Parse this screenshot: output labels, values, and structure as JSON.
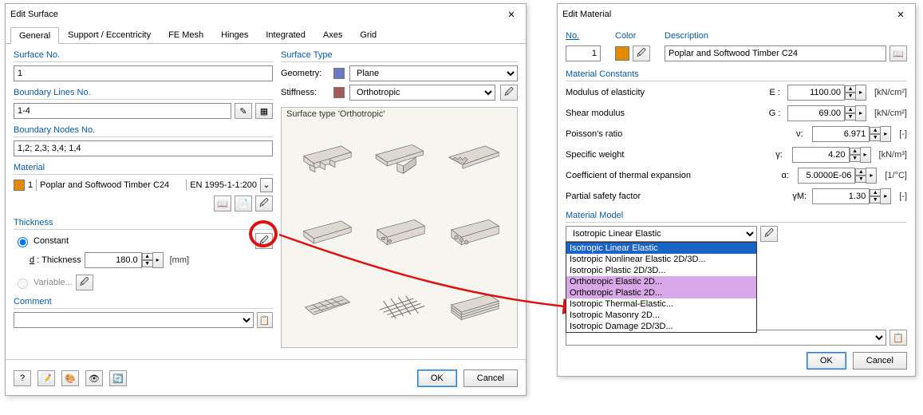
{
  "dlg1": {
    "title": "Edit Surface",
    "tabs": [
      "General",
      "Support / Eccentricity",
      "FE Mesh",
      "Hinges",
      "Integrated",
      "Axes",
      "Grid"
    ],
    "g_surface_no": "Surface No.",
    "surface_no": "1",
    "g_boundary_lines": "Boundary Lines No.",
    "boundary_lines": "1-4",
    "g_boundary_nodes": "Boundary Nodes No.",
    "boundary_nodes": "1,2; 2,3; 3,4; 1,4",
    "g_material": "Material",
    "material_index": "1",
    "material_name": "Poplar and Softwood Timber C24",
    "material_std": "EN 1995-1-1:200",
    "g_thickness": "Thickness",
    "thk_constant": "Constant",
    "thk_label": "Thickness d:",
    "thk_value": "180.0",
    "thk_unit": "[mm]",
    "thk_variable": "Variable...",
    "g_comment": "Comment",
    "g_surface_type": "Surface Type",
    "lbl_geometry": "Geometry:",
    "geometry": "Plane",
    "lbl_stiffness": "Stiffness:",
    "stiffness": "Orthotropic",
    "preview_caption": "Surface type 'Orthotropic'",
    "ok": "OK",
    "cancel": "Cancel"
  },
  "dlg2": {
    "title": "Edit Material",
    "lbl_no": "No.",
    "no": "1",
    "lbl_color": "Color",
    "lbl_desc": "Description",
    "desc": "Poplar and Softwood Timber C24",
    "g_constants": "Material Constants",
    "rows": [
      {
        "lbl": "Modulus of elasticity",
        "sym": "E :",
        "val": "1100.00",
        "unit": "[kN/cm²]",
        "u": "M"
      },
      {
        "lbl": "Shear modulus",
        "sym": "G :",
        "val": "69.00",
        "unit": "[kN/cm²]",
        "u": "S"
      },
      {
        "lbl": "Poisson's ratio",
        "sym": "ν:",
        "val": "6.971",
        "unit": "[-]",
        "u": "P"
      },
      {
        "lbl": "Specific weight",
        "sym": "γ:",
        "val": "4.20",
        "unit": "[kN/m³]",
        "u": ""
      },
      {
        "lbl": "Coefficient of thermal expansion",
        "sym": "α:",
        "val": "5.0000E-06",
        "unit": "[1/°C]",
        "u": "C"
      },
      {
        "lbl": "Partial safety factor",
        "sym": "γM:",
        "val": "1.30",
        "unit": "[-]",
        "u": "P"
      }
    ],
    "g_model": "Material Model",
    "model_selected": "Isotropic Linear Elastic",
    "model_options": [
      "Isotropic Linear Elastic",
      "Isotropic Nonlinear Elastic 2D/3D...",
      "Isotropic Plastic 2D/3D...",
      "Orthotropic Elastic 2D...",
      "Orthotropic Plastic 2D...",
      "Isotropic Thermal-Elastic...",
      "Isotropic Masonry 2D...",
      "Isotropic Damage 2D/3D..."
    ],
    "ok": "OK",
    "cancel": "Cancel"
  }
}
